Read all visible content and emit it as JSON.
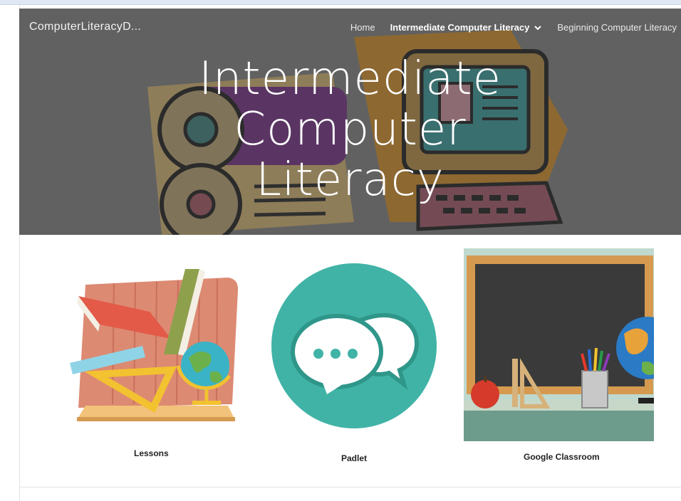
{
  "header": {
    "site_title": "ComputerLiteracyD...",
    "nav": [
      {
        "label": "Home",
        "active": false
      },
      {
        "label": "Intermediate Computer Literacy",
        "active": true,
        "has_dropdown": true
      },
      {
        "label": "Beginning Computer Literacy",
        "active": false
      }
    ]
  },
  "hero": {
    "title_lines": [
      "Intermediate",
      "Computer",
      "Literacy"
    ]
  },
  "tiles": [
    {
      "label": "Lessons",
      "icon": "lessons-illustration"
    },
    {
      "label": "Padlet",
      "icon": "chat-bubbles-icon"
    },
    {
      "label": "Google Classroom",
      "icon": "classroom-chalkboard-image"
    }
  ],
  "colors": {
    "padlet_teal": "#40b3a6",
    "hero_overlay": "#3c3c3c"
  }
}
